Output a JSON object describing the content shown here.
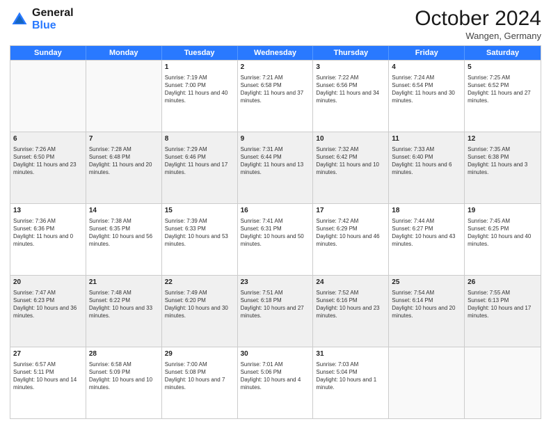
{
  "header": {
    "logo_line1": "General",
    "logo_line2": "Blue",
    "month": "October 2024",
    "location": "Wangen, Germany"
  },
  "days": [
    "Sunday",
    "Monday",
    "Tuesday",
    "Wednesday",
    "Thursday",
    "Friday",
    "Saturday"
  ],
  "weeks": [
    [
      {
        "day": "",
        "info": ""
      },
      {
        "day": "",
        "info": ""
      },
      {
        "day": "1",
        "info": "Sunrise: 7:19 AM\nSunset: 7:00 PM\nDaylight: 11 hours and 40 minutes."
      },
      {
        "day": "2",
        "info": "Sunrise: 7:21 AM\nSunset: 6:58 PM\nDaylight: 11 hours and 37 minutes."
      },
      {
        "day": "3",
        "info": "Sunrise: 7:22 AM\nSunset: 6:56 PM\nDaylight: 11 hours and 34 minutes."
      },
      {
        "day": "4",
        "info": "Sunrise: 7:24 AM\nSunset: 6:54 PM\nDaylight: 11 hours and 30 minutes."
      },
      {
        "day": "5",
        "info": "Sunrise: 7:25 AM\nSunset: 6:52 PM\nDaylight: 11 hours and 27 minutes."
      }
    ],
    [
      {
        "day": "6",
        "info": "Sunrise: 7:26 AM\nSunset: 6:50 PM\nDaylight: 11 hours and 23 minutes."
      },
      {
        "day": "7",
        "info": "Sunrise: 7:28 AM\nSunset: 6:48 PM\nDaylight: 11 hours and 20 minutes."
      },
      {
        "day": "8",
        "info": "Sunrise: 7:29 AM\nSunset: 6:46 PM\nDaylight: 11 hours and 17 minutes."
      },
      {
        "day": "9",
        "info": "Sunrise: 7:31 AM\nSunset: 6:44 PM\nDaylight: 11 hours and 13 minutes."
      },
      {
        "day": "10",
        "info": "Sunrise: 7:32 AM\nSunset: 6:42 PM\nDaylight: 11 hours and 10 minutes."
      },
      {
        "day": "11",
        "info": "Sunrise: 7:33 AM\nSunset: 6:40 PM\nDaylight: 11 hours and 6 minutes."
      },
      {
        "day": "12",
        "info": "Sunrise: 7:35 AM\nSunset: 6:38 PM\nDaylight: 11 hours and 3 minutes."
      }
    ],
    [
      {
        "day": "13",
        "info": "Sunrise: 7:36 AM\nSunset: 6:36 PM\nDaylight: 11 hours and 0 minutes."
      },
      {
        "day": "14",
        "info": "Sunrise: 7:38 AM\nSunset: 6:35 PM\nDaylight: 10 hours and 56 minutes."
      },
      {
        "day": "15",
        "info": "Sunrise: 7:39 AM\nSunset: 6:33 PM\nDaylight: 10 hours and 53 minutes."
      },
      {
        "day": "16",
        "info": "Sunrise: 7:41 AM\nSunset: 6:31 PM\nDaylight: 10 hours and 50 minutes."
      },
      {
        "day": "17",
        "info": "Sunrise: 7:42 AM\nSunset: 6:29 PM\nDaylight: 10 hours and 46 minutes."
      },
      {
        "day": "18",
        "info": "Sunrise: 7:44 AM\nSunset: 6:27 PM\nDaylight: 10 hours and 43 minutes."
      },
      {
        "day": "19",
        "info": "Sunrise: 7:45 AM\nSunset: 6:25 PM\nDaylight: 10 hours and 40 minutes."
      }
    ],
    [
      {
        "day": "20",
        "info": "Sunrise: 7:47 AM\nSunset: 6:23 PM\nDaylight: 10 hours and 36 minutes."
      },
      {
        "day": "21",
        "info": "Sunrise: 7:48 AM\nSunset: 6:22 PM\nDaylight: 10 hours and 33 minutes."
      },
      {
        "day": "22",
        "info": "Sunrise: 7:49 AM\nSunset: 6:20 PM\nDaylight: 10 hours and 30 minutes."
      },
      {
        "day": "23",
        "info": "Sunrise: 7:51 AM\nSunset: 6:18 PM\nDaylight: 10 hours and 27 minutes."
      },
      {
        "day": "24",
        "info": "Sunrise: 7:52 AM\nSunset: 6:16 PM\nDaylight: 10 hours and 23 minutes."
      },
      {
        "day": "25",
        "info": "Sunrise: 7:54 AM\nSunset: 6:14 PM\nDaylight: 10 hours and 20 minutes."
      },
      {
        "day": "26",
        "info": "Sunrise: 7:55 AM\nSunset: 6:13 PM\nDaylight: 10 hours and 17 minutes."
      }
    ],
    [
      {
        "day": "27",
        "info": "Sunrise: 6:57 AM\nSunset: 5:11 PM\nDaylight: 10 hours and 14 minutes."
      },
      {
        "day": "28",
        "info": "Sunrise: 6:58 AM\nSunset: 5:09 PM\nDaylight: 10 hours and 10 minutes."
      },
      {
        "day": "29",
        "info": "Sunrise: 7:00 AM\nSunset: 5:08 PM\nDaylight: 10 hours and 7 minutes."
      },
      {
        "day": "30",
        "info": "Sunrise: 7:01 AM\nSunset: 5:06 PM\nDaylight: 10 hours and 4 minutes."
      },
      {
        "day": "31",
        "info": "Sunrise: 7:03 AM\nSunset: 5:04 PM\nDaylight: 10 hours and 1 minute."
      },
      {
        "day": "",
        "info": ""
      },
      {
        "day": "",
        "info": ""
      }
    ]
  ]
}
